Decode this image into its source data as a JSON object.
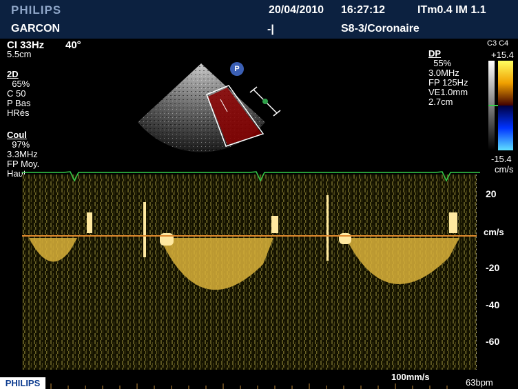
{
  "header": {
    "brand": "PHILIPS",
    "patient": "GARCON",
    "date": "20/04/2010",
    "time": "16:27:12",
    "index": "ITm0.4  IM 1.1",
    "marker": "-|",
    "probe_preset": "S8-3/Coronaire"
  },
  "left_panel": {
    "ci": "CI 33Hz",
    "angle": "40°",
    "depth": "5.5cm",
    "twoD": {
      "title": "2D",
      "lines": [
        "  65%",
        "C 50",
        "P Bas",
        "HRés"
      ]
    },
    "coul": {
      "title": "Coul",
      "lines": [
        "  97%",
        "3.3MHz",
        "FP Moy.",
        "Haut"
      ]
    }
  },
  "right_panel": {
    "dp": {
      "title": "DP",
      "lines": [
        "  55%",
        "3.0MHz",
        "FP 125Hz",
        "VE1.0mm",
        "2.7cm"
      ]
    },
    "c3c4": "C3 C4",
    "scale_top": "+15.4",
    "scale_bottom": "-15.4",
    "scale_unit": "cm/s",
    "colors": {
      "positive": "#f0c000",
      "negative": "#0033ff",
      "doppler": "#e0b640",
      "baseline": "#e08a2e",
      "ecg": "#35d04a"
    }
  },
  "sector_badge": "P",
  "axis": {
    "unit": "cm/s",
    "ticks": [
      "20",
      "-20",
      "-40",
      "-60"
    ],
    "tick_values": [
      20,
      -20,
      -40,
      -60
    ],
    "range": [
      31,
      -75
    ]
  },
  "footer": {
    "brand": "PHILIPS",
    "sweep_speed": "100mm/s",
    "heart_rate": "63bpm"
  }
}
